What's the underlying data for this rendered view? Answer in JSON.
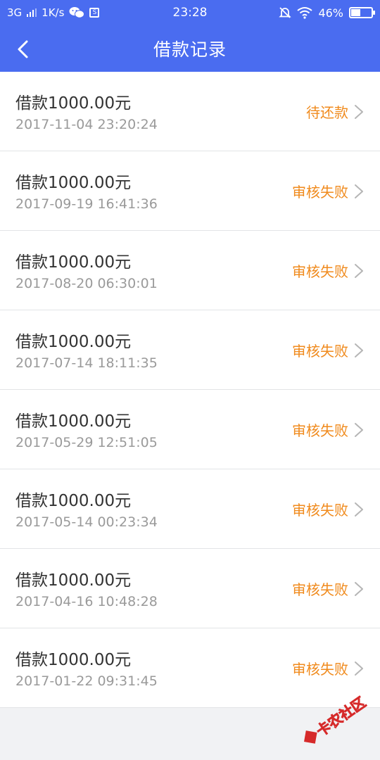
{
  "status_bar": {
    "network": "3G",
    "speed": "1K/s",
    "time": "23:28",
    "battery": "46%",
    "battery_level": 0.46
  },
  "nav": {
    "title": "借款记录",
    "back_icon": "chevron-left-icon"
  },
  "colors": {
    "primary": "#4a6cf0",
    "status_orange": "#f08a1c",
    "amount_text": "#333333",
    "time_text": "#9a9a9a",
    "background": "#f1f2f4"
  },
  "records": [
    {
      "amount": "借款1000.00元",
      "time": "2017-11-04 23:20:24",
      "status": "待还款"
    },
    {
      "amount": "借款1000.00元",
      "time": "2017-09-19 16:41:36",
      "status": "审核失败"
    },
    {
      "amount": "借款1000.00元",
      "time": "2017-08-20 06:30:01",
      "status": "审核失败"
    },
    {
      "amount": "借款1000.00元",
      "time": "2017-07-14 18:11:35",
      "status": "审核失败"
    },
    {
      "amount": "借款1000.00元",
      "time": "2017-05-29 12:51:05",
      "status": "审核失败"
    },
    {
      "amount": "借款1000.00元",
      "time": "2017-05-14 00:23:34",
      "status": "审核失败"
    },
    {
      "amount": "借款1000.00元",
      "time": "2017-04-16 10:48:28",
      "status": "审核失败"
    },
    {
      "amount": "借款1000.00元",
      "time": "2017-01-22 09:31:45",
      "status": "审核失败"
    }
  ],
  "watermark": "卡农社区"
}
